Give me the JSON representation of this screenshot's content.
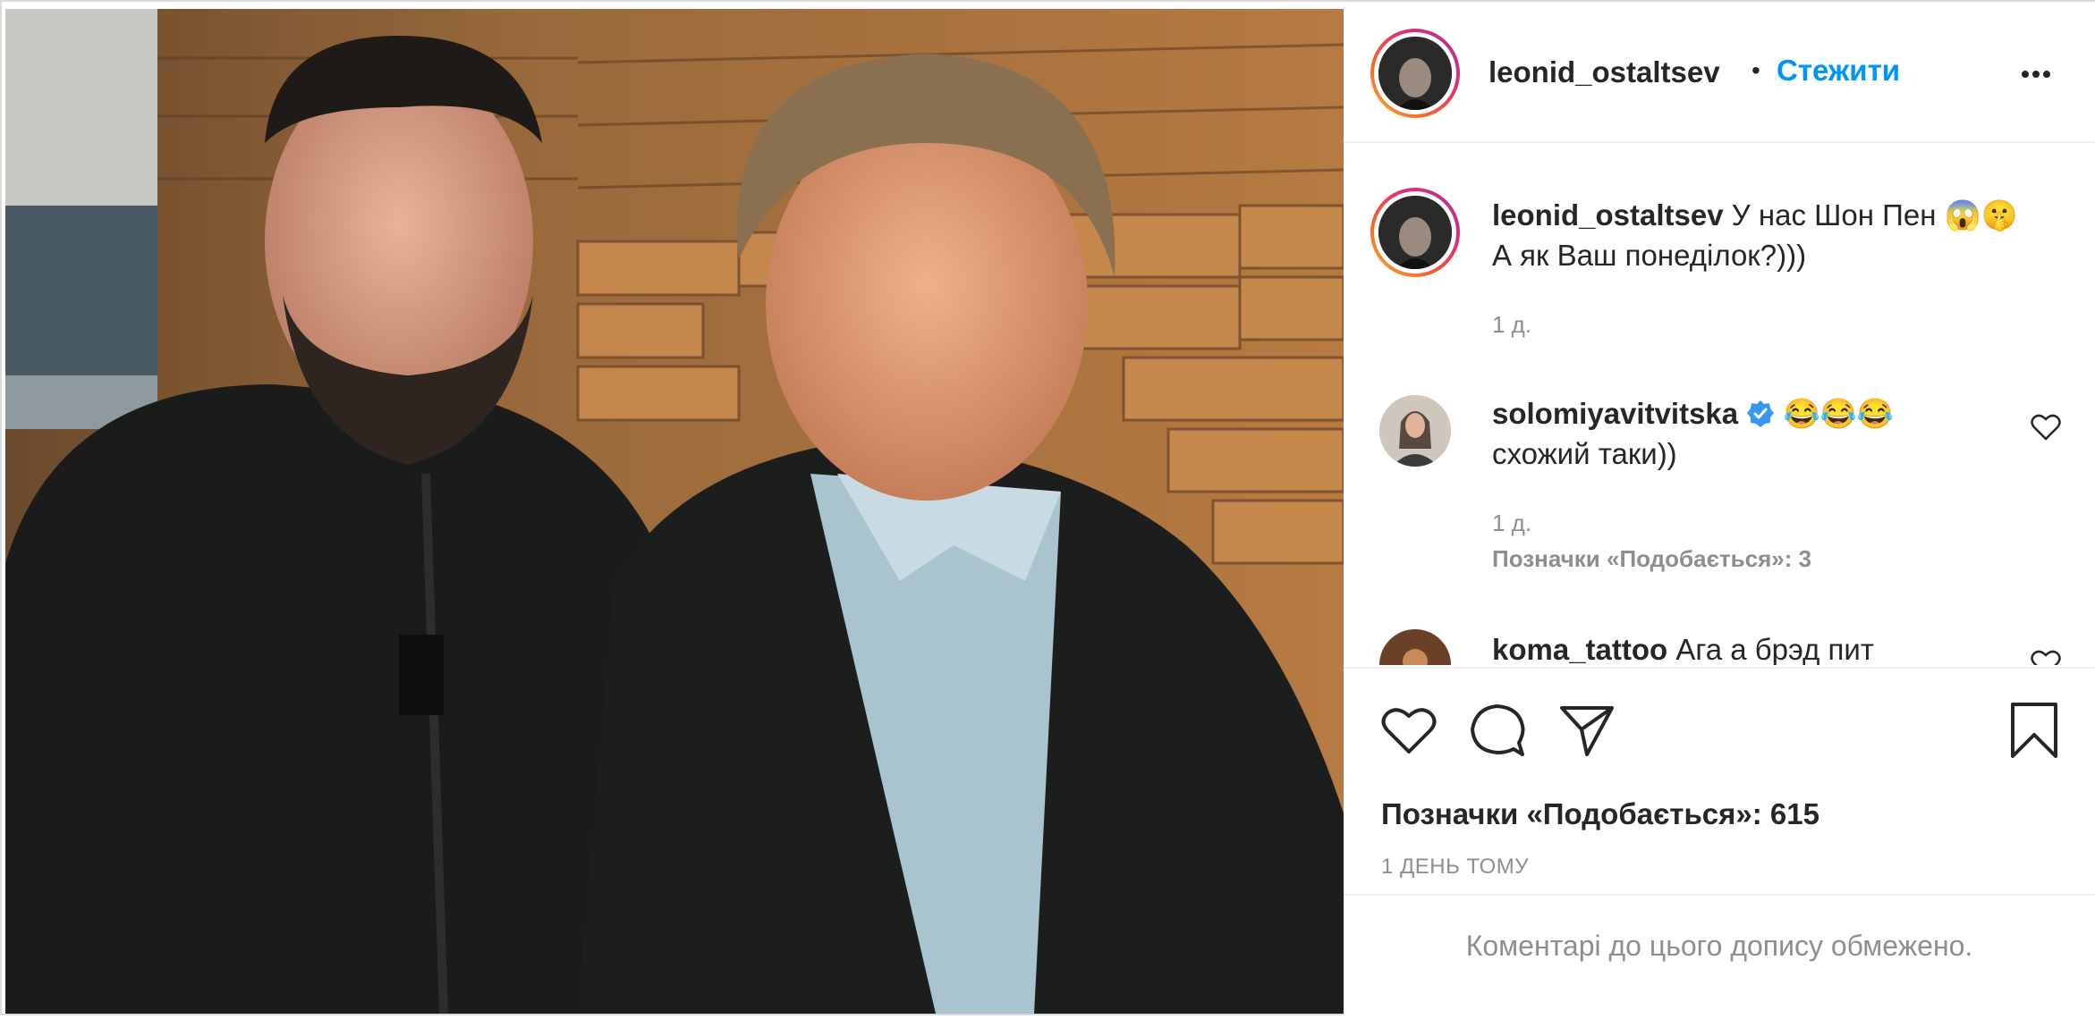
{
  "post": {
    "author": {
      "username": "leonid_ostaltsev",
      "separator": "•",
      "follow_label": "Стежити"
    },
    "caption": {
      "username": "leonid_ostaltsev",
      "line1": "У нас Шон Пен 😱🤫",
      "line2": "А як Ваш понеділок?)))",
      "time": "1 д."
    },
    "comments": [
      {
        "username": "solomiyavitvitska",
        "verified": true,
        "emoji": "😂😂😂",
        "text": "схожий таки))",
        "time": "1 д.",
        "likes_label": "Позначки «Подобається»: 3"
      },
      {
        "username": "koma_tattoo",
        "text": "Ага а брэд пит"
      }
    ],
    "likes_label": "Позначки «Подобається»: 615",
    "posted_ago": "1 ДЕНЬ ТОМУ",
    "comments_disabled": "Коментарі до цього допису обмежено.",
    "accent_color": "#0095f6",
    "icons": [
      "more-options-icon",
      "heart-icon",
      "comment-icon",
      "share-icon",
      "bookmark-icon",
      "verified-badge-icon"
    ]
  }
}
